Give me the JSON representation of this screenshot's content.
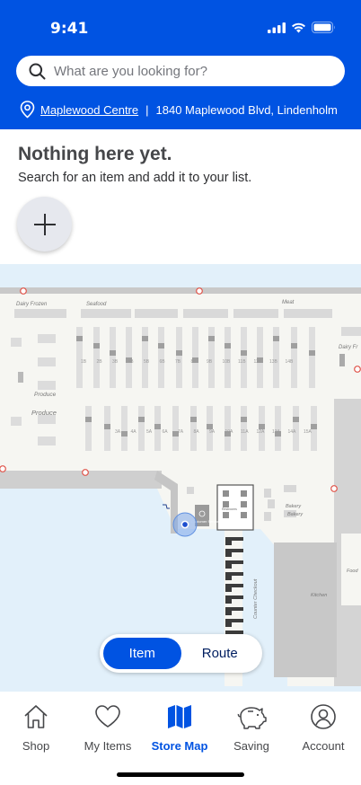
{
  "status_bar": {
    "time": "9:41"
  },
  "search": {
    "placeholder": "What are you looking for?"
  },
  "location": {
    "store_name": "Maplewood Centre",
    "separator": "|",
    "address": "1840 Maplewood Blvd, Lindenholm"
  },
  "empty_state": {
    "title": "Nothing here yet.",
    "subtitle": "Search for an item and add it to your list."
  },
  "map": {
    "labels": {
      "dairy_frozen": "Dairy Frozen",
      "seafood": "Seafood",
      "meat": "Meat",
      "dairy_right": "Dairy Fr",
      "produce_1": "Produce",
      "produce_2": "Produce",
      "bakery": "Bakery",
      "counter_checkout": "Counter Checkout",
      "kitchen": "Kitchen",
      "food": "Food",
      "customer_service": "Customer Service",
      "restrooms": "Restrooms"
    },
    "aisles_top": [
      "1B",
      "2B",
      "3B",
      "4B",
      "5B",
      "6B",
      "7B",
      "8B",
      "9B",
      "10B",
      "11B",
      "12B",
      "13B",
      "14B"
    ],
    "aisles_bottom": [
      "3A",
      "4A",
      "5A",
      "6A",
      "7A",
      "8A",
      "9A",
      "10A",
      "11A",
      "12A",
      "13A",
      "14A",
      "15A"
    ],
    "view_toggle": {
      "item": "Item",
      "route": "Route",
      "selected": "Item"
    }
  },
  "nav": {
    "items": [
      {
        "label": "Shop",
        "icon": "home-icon"
      },
      {
        "label": "My Items",
        "icon": "heart-icon"
      },
      {
        "label": "Store Map",
        "icon": "map-icon"
      },
      {
        "label": "Saving",
        "icon": "piggy-bank-icon"
      },
      {
        "label": "Account",
        "icon": "account-icon"
      }
    ],
    "active": "Store Map"
  },
  "colors": {
    "brand_blue": "#0053e2",
    "navy": "#001e60",
    "map_floor": "#f6f6f2",
    "map_water": "#e2f0fa"
  }
}
